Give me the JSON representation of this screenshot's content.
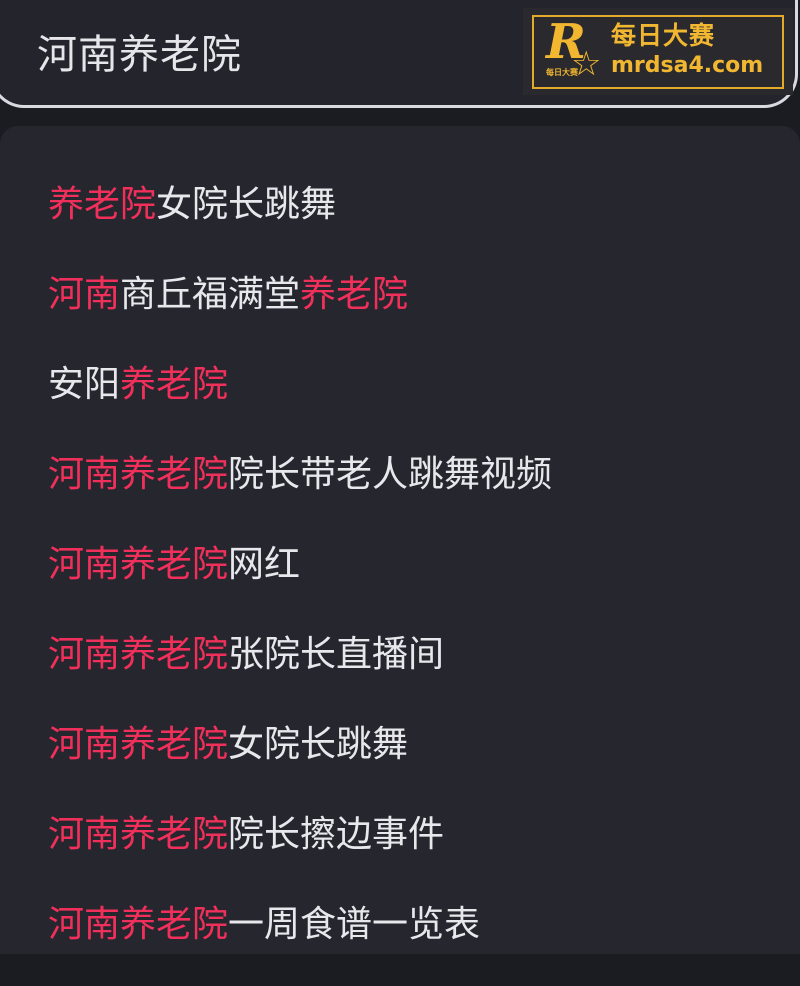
{
  "search": {
    "query": "河南养老院"
  },
  "watermark": {
    "logo_letter": "R",
    "logo_small_text": "每日大赛",
    "title": "每日大赛",
    "url": "mrdsa4.com"
  },
  "suggestions": [
    {
      "parts": [
        {
          "text": "养老院",
          "highlight": true
        },
        {
          "text": "女院长跳舞",
          "highlight": false
        }
      ]
    },
    {
      "parts": [
        {
          "text": "河南",
          "highlight": true
        },
        {
          "text": "商丘福满堂",
          "highlight": false
        },
        {
          "text": "养老院",
          "highlight": true
        }
      ]
    },
    {
      "parts": [
        {
          "text": "安阳",
          "highlight": false
        },
        {
          "text": "养老院",
          "highlight": true
        }
      ]
    },
    {
      "parts": [
        {
          "text": "河南养老院",
          "highlight": true
        },
        {
          "text": "院长带老人跳舞视频",
          "highlight": false
        }
      ]
    },
    {
      "parts": [
        {
          "text": "河南养老院",
          "highlight": true
        },
        {
          "text": "网红",
          "highlight": false
        }
      ]
    },
    {
      "parts": [
        {
          "text": "河南养老院",
          "highlight": true
        },
        {
          "text": "张院长直播间",
          "highlight": false
        }
      ]
    },
    {
      "parts": [
        {
          "text": "河南养老院",
          "highlight": true
        },
        {
          "text": "女院长跳舞",
          "highlight": false
        }
      ]
    },
    {
      "parts": [
        {
          "text": "河南养老院",
          "highlight": true
        },
        {
          "text": "院长擦边事件",
          "highlight": false
        }
      ]
    },
    {
      "parts": [
        {
          "text": "河南养老院",
          "highlight": true
        },
        {
          "text": "一周食谱一览表",
          "highlight": false
        }
      ]
    }
  ],
  "colors": {
    "background": "#1b1b22",
    "panel": "#26262f",
    "text": "#e8e8ec",
    "highlight": "#f0305a",
    "watermark_gold": "#f2b731"
  }
}
